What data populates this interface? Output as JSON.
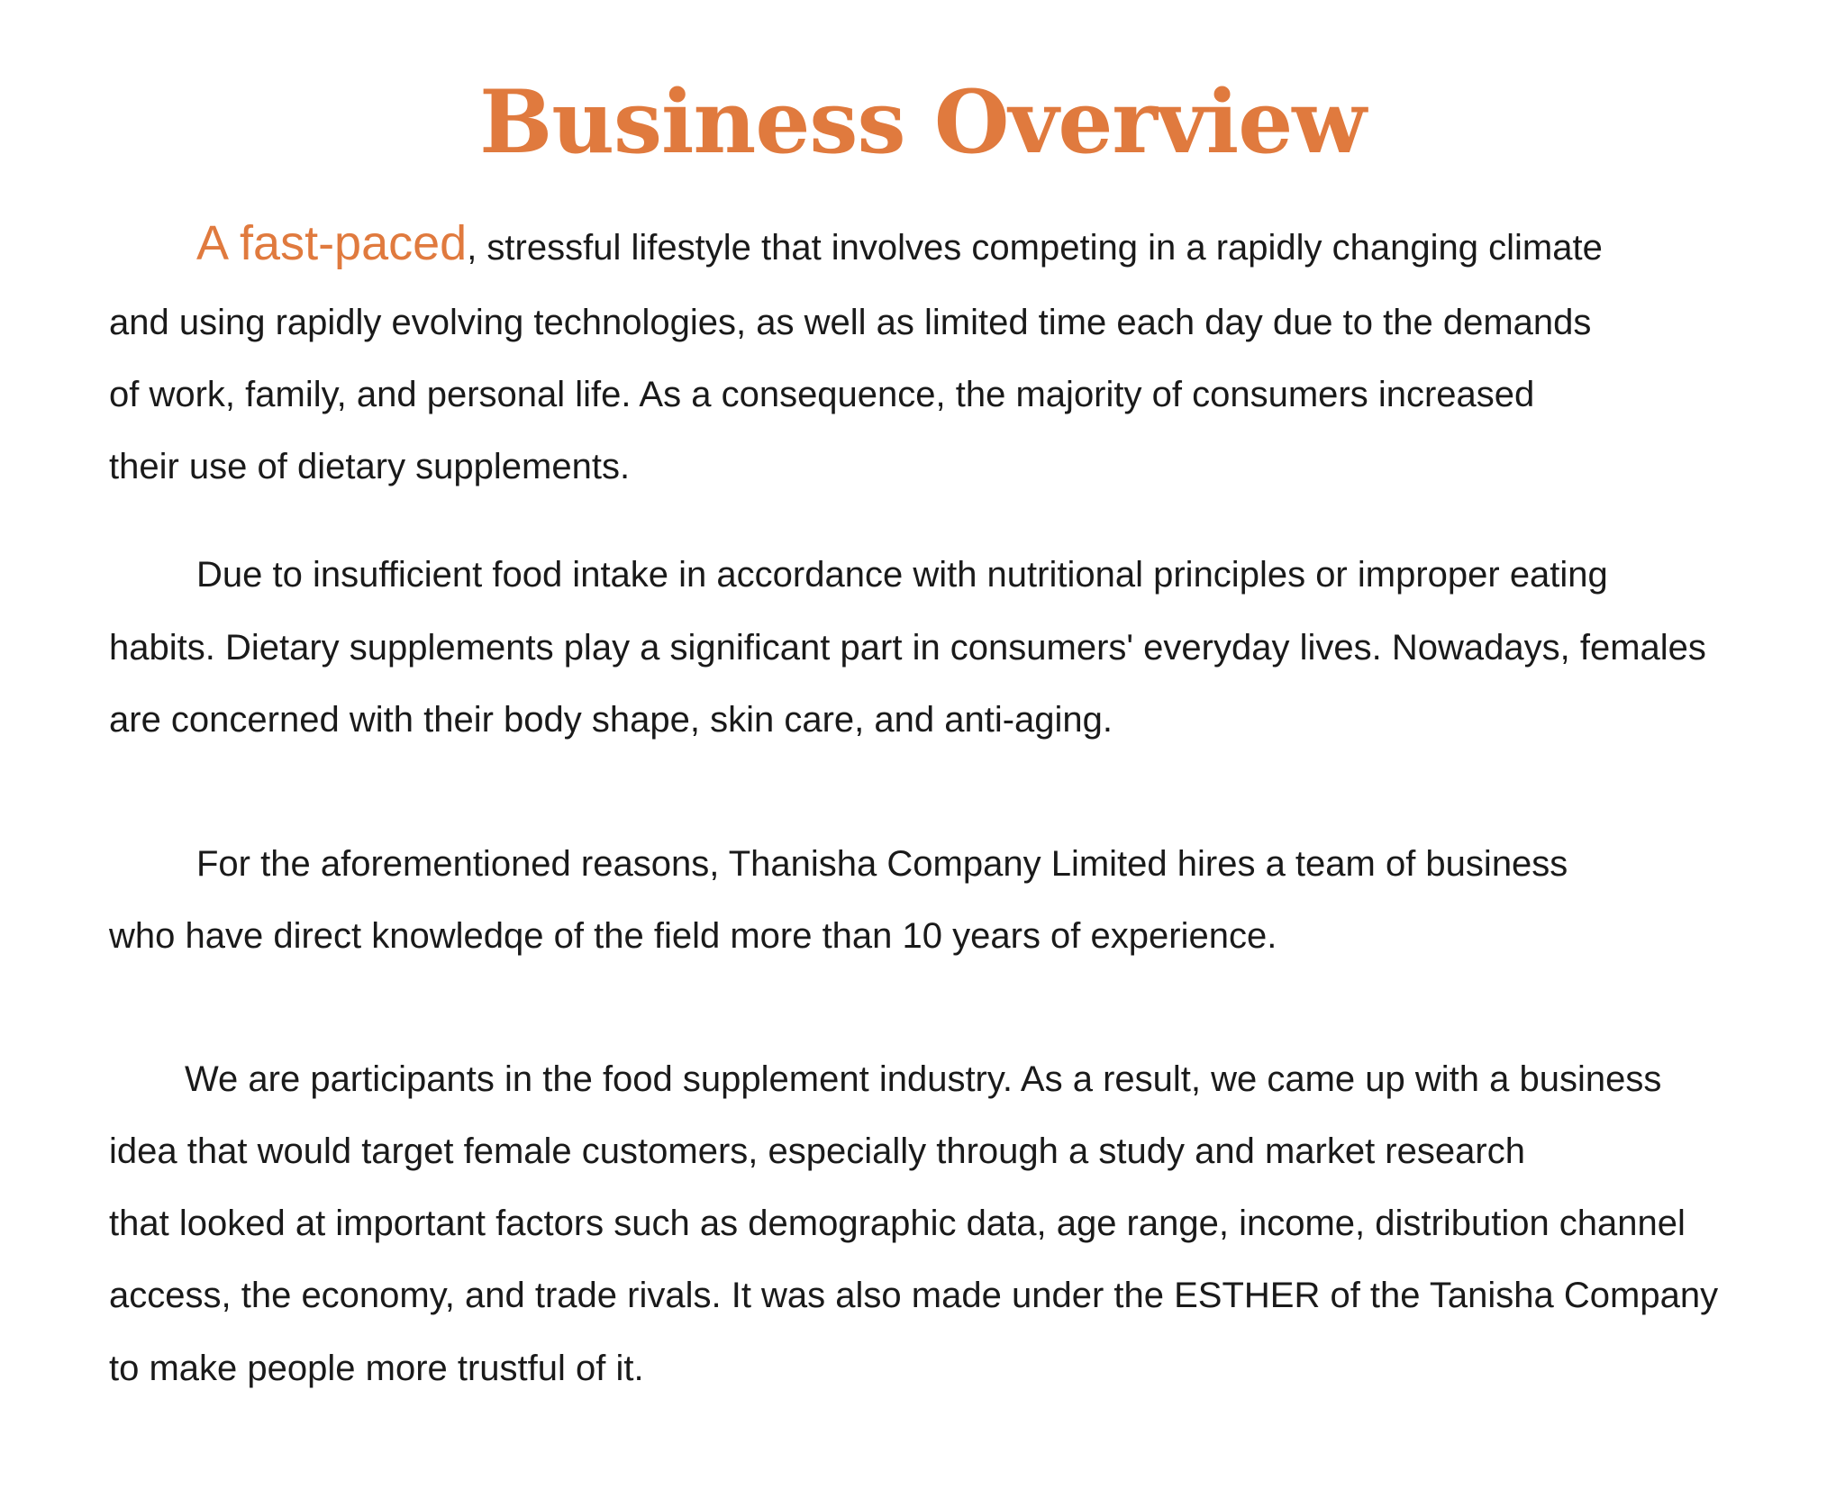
{
  "title": "Business Overview",
  "paragraphs": [
    {
      "lead": "A fast-paced",
      "lines": [
        ", stressful lifestyle that involves competing in a rapidly changing climate",
        "and using rapidly evolving technologies, as well as limited time each day due to the demands",
        "of work, family, and personal life. As a consequence, the majority of consumers increased",
        "their use of dietary supplements."
      ]
    },
    {
      "lines": [
        "Due to insufficient food intake in accordance with nutritional principles or improper eating",
        "habits. Dietary supplements play a significant part in consumers' everyday lives. Nowadays, females",
        "are concerned with their body shape, skin care, and anti-aging."
      ]
    },
    {
      "lines": [
        "For the aforementioned reasons, Thanisha Company Limited hires a team of business",
        "who have direct knowledqe of the field more than 10 years of experience."
      ]
    },
    {
      "lines": [
        "We are participants in the food supplement industry. As a result, we came up with a business",
        "idea that would target female customers, especially through a study and market research",
        "that looked at important factors such as demographic data, age range, income, distribution channel",
        "access, the economy, and trade rivals. It was also made under the ESTHER of the Tanisha Company",
        "to make people more trustful of it."
      ]
    }
  ]
}
